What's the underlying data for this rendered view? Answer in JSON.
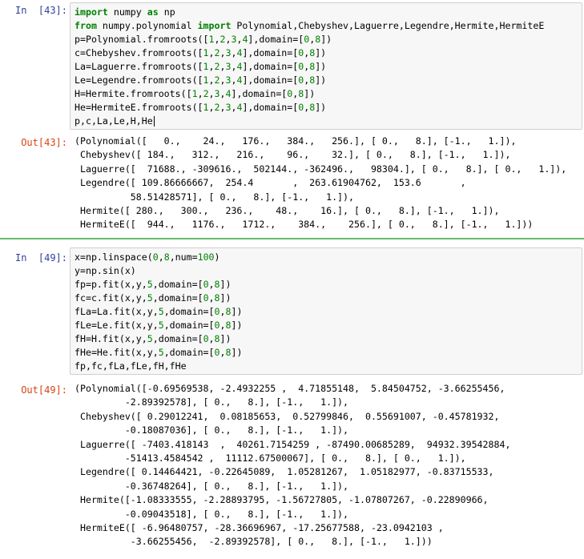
{
  "cells": [
    {
      "in_prompt": "In  [43]:",
      "out_prompt": "Out[43]:",
      "code": [
        [
          {
            "t": "import",
            "c": "kw"
          },
          {
            "t": " numpy "
          },
          {
            "t": "as",
            "c": "kw"
          },
          {
            "t": " np"
          }
        ],
        [
          {
            "t": "from",
            "c": "kw"
          },
          {
            "t": " numpy.polynomial "
          },
          {
            "t": "import",
            "c": "kw"
          },
          {
            "t": " Polynomial,Chebyshev,Laguerre,Legendre,Hermite,HermiteE"
          }
        ],
        [
          {
            "t": "p=Polynomial.fromroots(["
          },
          {
            "t": "1",
            "c": "num"
          },
          {
            "t": ","
          },
          {
            "t": "2",
            "c": "num"
          },
          {
            "t": ","
          },
          {
            "t": "3",
            "c": "num"
          },
          {
            "t": ","
          },
          {
            "t": "4",
            "c": "num"
          },
          {
            "t": "],domain=["
          },
          {
            "t": "0",
            "c": "num"
          },
          {
            "t": ","
          },
          {
            "t": "8",
            "c": "num"
          },
          {
            "t": "])"
          }
        ],
        [
          {
            "t": "c=Chebyshev.fromroots(["
          },
          {
            "t": "1",
            "c": "num"
          },
          {
            "t": ","
          },
          {
            "t": "2",
            "c": "num"
          },
          {
            "t": ","
          },
          {
            "t": "3",
            "c": "num"
          },
          {
            "t": ","
          },
          {
            "t": "4",
            "c": "num"
          },
          {
            "t": "],domain=["
          },
          {
            "t": "0",
            "c": "num"
          },
          {
            "t": ","
          },
          {
            "t": "8",
            "c": "num"
          },
          {
            "t": "])"
          }
        ],
        [
          {
            "t": "La=Laguerre.fromroots(["
          },
          {
            "t": "1",
            "c": "num"
          },
          {
            "t": ","
          },
          {
            "t": "2",
            "c": "num"
          },
          {
            "t": ","
          },
          {
            "t": "3",
            "c": "num"
          },
          {
            "t": ","
          },
          {
            "t": "4",
            "c": "num"
          },
          {
            "t": "],domain=["
          },
          {
            "t": "0",
            "c": "num"
          },
          {
            "t": ","
          },
          {
            "t": "8",
            "c": "num"
          },
          {
            "t": "])"
          }
        ],
        [
          {
            "t": "Le=Legendre.fromroots(["
          },
          {
            "t": "1",
            "c": "num"
          },
          {
            "t": ","
          },
          {
            "t": "2",
            "c": "num"
          },
          {
            "t": ","
          },
          {
            "t": "3",
            "c": "num"
          },
          {
            "t": ","
          },
          {
            "t": "4",
            "c": "num"
          },
          {
            "t": "],domain=["
          },
          {
            "t": "0",
            "c": "num"
          },
          {
            "t": ","
          },
          {
            "t": "8",
            "c": "num"
          },
          {
            "t": "])"
          }
        ],
        [
          {
            "t": "H=Hermite.fromroots(["
          },
          {
            "t": "1",
            "c": "num"
          },
          {
            "t": ","
          },
          {
            "t": "2",
            "c": "num"
          },
          {
            "t": ","
          },
          {
            "t": "3",
            "c": "num"
          },
          {
            "t": ","
          },
          {
            "t": "4",
            "c": "num"
          },
          {
            "t": "],domain=["
          },
          {
            "t": "0",
            "c": "num"
          },
          {
            "t": ","
          },
          {
            "t": "8",
            "c": "num"
          },
          {
            "t": "])"
          }
        ],
        [
          {
            "t": "He=HermiteE.fromroots(["
          },
          {
            "t": "1",
            "c": "num"
          },
          {
            "t": ","
          },
          {
            "t": "2",
            "c": "num"
          },
          {
            "t": ","
          },
          {
            "t": "3",
            "c": "num"
          },
          {
            "t": ","
          },
          {
            "t": "4",
            "c": "num"
          },
          {
            "t": "],domain=["
          },
          {
            "t": "0",
            "c": "num"
          },
          {
            "t": ","
          },
          {
            "t": "8",
            "c": "num"
          },
          {
            "t": "])"
          }
        ],
        [
          {
            "t": "p,c,La,Le,H,He"
          }
        ]
      ],
      "output": [
        "(Polynomial([   0.,    24.,   176.,   384.,   256.], [ 0.,   8.], [-1.,   1.]),",
        " Chebyshev([ 184.,   312.,   216.,    96.,    32.], [ 0.,   8.], [-1.,   1.]),",
        " Laguerre([  71688., -309616.,  502144., -362496.,   98304.], [ 0.,   8.], [ 0.,   1.]),",
        " Legendre([ 109.86666667,  254.4       ,  263.61904762,  153.6       ,",
        "          58.51428571], [ 0.,   8.], [-1.,   1.]),",
        " Hermite([ 280.,   300.,   236.,    48.,    16.], [ 0.,   8.], [-1.,   1.]),",
        " HermiteE([  944.,   1176.,   1712.,    384.,    256.], [ 0.,   8.], [-1.,   1.]))"
      ]
    },
    {
      "in_prompt": "In  [49]:",
      "out_prompt": "Out[49]:",
      "code": [
        [
          {
            "t": "x=np.linspace("
          },
          {
            "t": "0",
            "c": "num"
          },
          {
            "t": ","
          },
          {
            "t": "8",
            "c": "num"
          },
          {
            "t": ",num="
          },
          {
            "t": "100",
            "c": "num"
          },
          {
            "t": ")"
          }
        ],
        [
          {
            "t": "y=np.sin(x)"
          }
        ],
        [
          {
            "t": "fp=p.fit(x,y,"
          },
          {
            "t": "5",
            "c": "num"
          },
          {
            "t": ",domain=["
          },
          {
            "t": "0",
            "c": "num"
          },
          {
            "t": ","
          },
          {
            "t": "8",
            "c": "num"
          },
          {
            "t": "])"
          }
        ],
        [
          {
            "t": "fc=c.fit(x,y,"
          },
          {
            "t": "5",
            "c": "num"
          },
          {
            "t": ",domain=["
          },
          {
            "t": "0",
            "c": "num"
          },
          {
            "t": ","
          },
          {
            "t": "8",
            "c": "num"
          },
          {
            "t": "])"
          }
        ],
        [
          {
            "t": "fLa=La.fit(x,y,"
          },
          {
            "t": "5",
            "c": "num"
          },
          {
            "t": ",domain=["
          },
          {
            "t": "0",
            "c": "num"
          },
          {
            "t": ","
          },
          {
            "t": "8",
            "c": "num"
          },
          {
            "t": "])"
          }
        ],
        [
          {
            "t": "fLe=Le.fit(x,y,"
          },
          {
            "t": "5",
            "c": "num"
          },
          {
            "t": ",domain=["
          },
          {
            "t": "0",
            "c": "num"
          },
          {
            "t": ","
          },
          {
            "t": "8",
            "c": "num"
          },
          {
            "t": "])"
          }
        ],
        [
          {
            "t": "fH=H.fit(x,y,"
          },
          {
            "t": "5",
            "c": "num"
          },
          {
            "t": ",domain=["
          },
          {
            "t": "0",
            "c": "num"
          },
          {
            "t": ","
          },
          {
            "t": "8",
            "c": "num"
          },
          {
            "t": "])"
          }
        ],
        [
          {
            "t": "fHe=He.fit(x,y,"
          },
          {
            "t": "5",
            "c": "num"
          },
          {
            "t": ",domain=["
          },
          {
            "t": "0",
            "c": "num"
          },
          {
            "t": ","
          },
          {
            "t": "8",
            "c": "num"
          },
          {
            "t": "])"
          }
        ],
        [
          {
            "t": "fp,fc,fLa,fLe,fH,fHe"
          }
        ]
      ],
      "output": [
        "(Polynomial([-0.69569538, -2.4932255 ,  4.71855148,  5.84504752, -3.66255456,",
        "         -2.89392578], [ 0.,   8.], [-1.,   1.]),",
        " Chebyshev([ 0.29012241,  0.08185653,  0.52799846,  0.55691007, -0.45781932,",
        "         -0.18087036], [ 0.,   8.], [-1.,   1.]),",
        " Laguerre([ -7403.418143  ,  40261.7154259 , -87490.00685289,  94932.39542884,",
        "         -51413.4584542 ,  11112.67500067], [ 0.,   8.], [ 0.,   1.]),",
        " Legendre([ 0.14464421, -0.22645089,  1.05281267,  1.05182977, -0.83715533,",
        "         -0.36748264], [ 0.,   8.], [-1.,   1.]),",
        " Hermite([-1.08333555, -2.28893795, -1.56727805, -1.07807267, -0.22890966,",
        "         -0.09043518], [ 0.,   8.], [-1.,   1.]),",
        " HermiteE([ -6.96480757, -28.36696967, -17.25677588, -23.0942103 ,",
        "          -3.66255456,  -2.89392578], [ 0.,   8.], [-1.,   1.]))"
      ]
    }
  ],
  "colors": {
    "in_prompt": "#303f9f",
    "out_prompt": "#d84315",
    "keyword": "#008000",
    "number": "#008000",
    "input_bg": "#f7f7f7",
    "cell_separator": "#66bb6a",
    "selection_bar": "#42a5f5"
  }
}
